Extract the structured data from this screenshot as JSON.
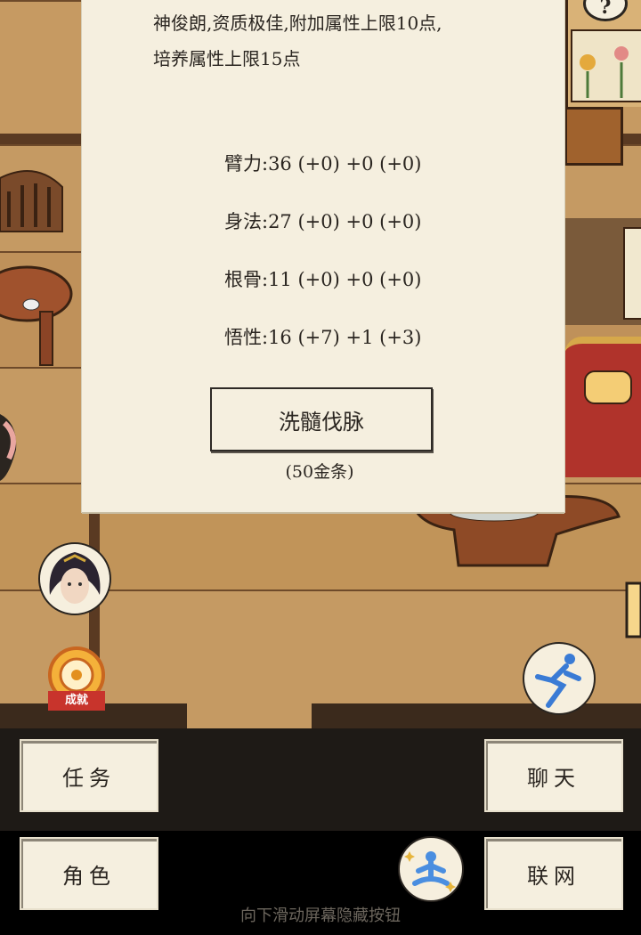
{
  "panel": {
    "desc_line1": "神俊朗,资质极佳,附加属性上限10点,",
    "desc_line2": "培养属性上限15点",
    "stats": [
      {
        "label": "臂力:36 (+0) +0 (+0)"
      },
      {
        "label": "身法:27 (+0) +0 (+0)"
      },
      {
        "label": "根骨:11 (+0) +0 (+0)"
      },
      {
        "label": "悟性:16 (+7) +1 (+3)"
      }
    ],
    "wash_button": "洗髓伐脉",
    "cost": "(50金条)",
    "help_icon": "?"
  },
  "achievement_badge": "成就",
  "menu": {
    "task": "任务",
    "chat": "聊天",
    "role": "角色",
    "network": "联网"
  },
  "hint": "向下滑动屏幕隐藏按钮",
  "colors": {
    "panel_bg": "#f5efdf",
    "text": "#2a2520",
    "floor": "#c59a63",
    "bottom_bar": "#000000"
  },
  "icons": [
    "question-icon",
    "character-portrait-icon",
    "achievement-icon",
    "run-icon",
    "meditate-icon"
  ]
}
